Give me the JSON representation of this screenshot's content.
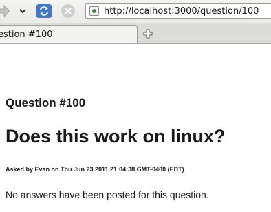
{
  "browser": {
    "url": "http://localhost:3000/question/100",
    "tab_title": "estion #100",
    "icons": {
      "forward": "forward-arrow-icon",
      "history": "chevron-down-icon",
      "reload": "reload-icon",
      "stop": "stop-icon",
      "site": "site-identity-icon",
      "new_tab": "new-tab-icon"
    }
  },
  "question": {
    "number_label": "Question #100",
    "title": "Does this work on linux?",
    "asked_by": "Asked by Evan on Thu Jun 23 2011 21:04:38 GMT-0400 (EDT)",
    "answers_text": "No answers have been posted for this question."
  }
}
